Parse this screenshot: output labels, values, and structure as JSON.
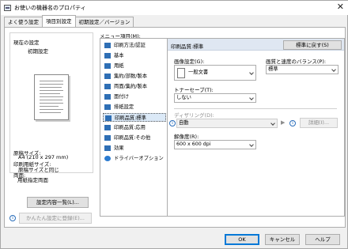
{
  "window": {
    "title": "お使いの機器名のプロパティ",
    "close_glyph": "✕"
  },
  "tabs": [
    "よく使う設定",
    "項目別設定",
    "初期設定／バージョン"
  ],
  "left": {
    "current_settings_label": "現在の設定",
    "preview_caption": "初期設定",
    "summary": [
      "原稿サイズ:",
      "A4 (210 x 297 mm)",
      "印刷用紙サイズ:",
      "原稿サイズと同じ",
      "両面:",
      "用紙指定両面"
    ],
    "settings_list_button": "設定内容一覧(L)...",
    "register_favorite_button": "かんたん設定に登録(E)..."
  },
  "menu": {
    "label": "メニュー項目(M):",
    "items": [
      "印刷方法/認証",
      "基本",
      "用紙",
      "集約/部数/製本",
      "両面/集約/製本",
      "面付け",
      "排紙設定",
      "印刷品質:標準",
      "印刷品質:応用",
      "印刷品質:その他",
      "効果",
      "ドライバーオプション"
    ],
    "selected_index": 7
  },
  "detail": {
    "header": "印刷品質:標準",
    "restore_default_button": "標準に戻す(S)",
    "document_type_label": "画像設定(G):",
    "document_type_value": "一般文書",
    "quality_speed_label": "画質と速度のバランス(P):",
    "quality_speed_value": "標準",
    "toner_saving_label": "トナーセーブ(T):",
    "toner_saving_value": "しない",
    "dithering_label": "ディザリング(D):",
    "dithering_value": "自動",
    "dithering_detail_button": "詳細(I)...",
    "resolution_label": "解像度(R):",
    "resolution_value": "600 x 600 dpi"
  },
  "footer": {
    "ok": "OK",
    "cancel": "キャンセル",
    "help": "ヘルプ"
  },
  "colors": {
    "accent": "#0078d7",
    "header_bg": "#dfe7f2",
    "icon_blue": "#2f6fb5"
  }
}
